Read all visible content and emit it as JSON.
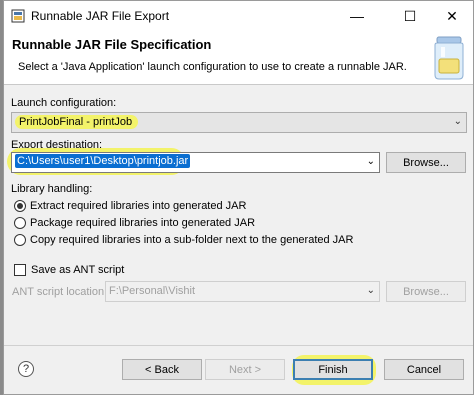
{
  "window": {
    "title": "Runnable JAR File Export",
    "minimize_glyph": "—",
    "maximize_glyph": "☐",
    "close_glyph": "✕"
  },
  "banner": {
    "title": "Runnable JAR File Specification",
    "description": "Select a 'Java Application' launch configuration to use to create a runnable JAR."
  },
  "launch": {
    "label": "Launch configuration:",
    "value": "PrintJobFinal - printJob"
  },
  "export": {
    "label": "Export destination:",
    "value": "C:\\Users\\user1\\Desktop\\printjob.jar",
    "browse_label": "Browse..."
  },
  "library": {
    "label": "Library handling:",
    "options": [
      {
        "label": "Extract required libraries into generated JAR",
        "checked": true
      },
      {
        "label": "Package required libraries into generated JAR",
        "checked": false
      },
      {
        "label": "Copy required libraries into a sub-folder next to the generated JAR",
        "checked": false
      }
    ]
  },
  "ant": {
    "checkbox_label": "Save as ANT script",
    "location_label": "ANT script location:",
    "location_value": "F:\\Personal\\Vishit",
    "browse_label": "Browse..."
  },
  "footer": {
    "help_glyph": "?",
    "back_label": "< Back",
    "next_label": "Next >",
    "finish_label": "Finish",
    "cancel_label": "Cancel"
  },
  "icons": {
    "app": "jar-file-icon",
    "banner": "jar-export-icon",
    "dropdown": "chevron-down-icon"
  },
  "colors": {
    "highlight": "#f3f36a",
    "selection": "#0a6ed1",
    "primary_border": "#3c7fb1"
  }
}
